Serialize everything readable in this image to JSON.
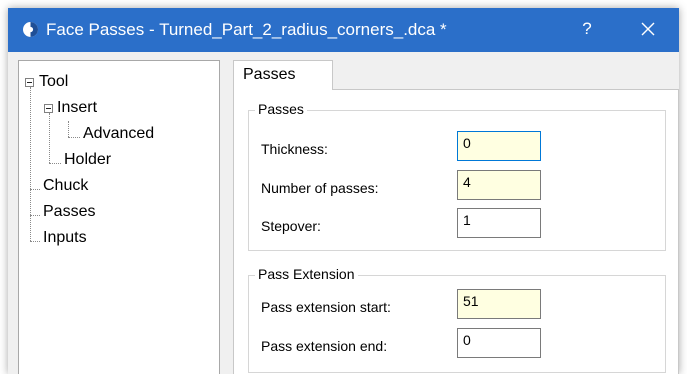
{
  "window": {
    "title": "Face Passes - Turned_Part_2_radius_corners_.dca *",
    "help_label": "?",
    "titlebar_color": "#2b6fc9",
    "icons": {
      "app": "app-logo-icon",
      "close": "close-icon"
    }
  },
  "tree": {
    "items": [
      {
        "label": "Tool",
        "level": 0,
        "expanded": true
      },
      {
        "label": "Insert",
        "level": 1,
        "expanded": true
      },
      {
        "label": "Advanced",
        "level": 2
      },
      {
        "label": "Holder",
        "level": 1
      },
      {
        "label": "Chuck",
        "level": 0
      },
      {
        "label": "Passes",
        "level": 0
      },
      {
        "label": "Inputs",
        "level": 0
      }
    ]
  },
  "tabs": [
    {
      "label": "Passes",
      "active": true
    }
  ],
  "groups": {
    "passes": {
      "title": "Passes",
      "fields": [
        {
          "label": "Thickness:",
          "value": "0",
          "changed": true,
          "focused": true
        },
        {
          "label": "Number of passes:",
          "value": "4",
          "changed": true
        },
        {
          "label": "Stepover:",
          "value": "1",
          "changed": false
        }
      ]
    },
    "pass_extension": {
      "title": "Pass Extension",
      "fields": [
        {
          "label": "Pass extension start:",
          "value": "51",
          "changed": true
        },
        {
          "label": "Pass extension end:",
          "value": "0",
          "changed": false
        }
      ]
    }
  },
  "colors": {
    "changed_field": "#ffffe1",
    "focus_border": "#0078d7"
  }
}
